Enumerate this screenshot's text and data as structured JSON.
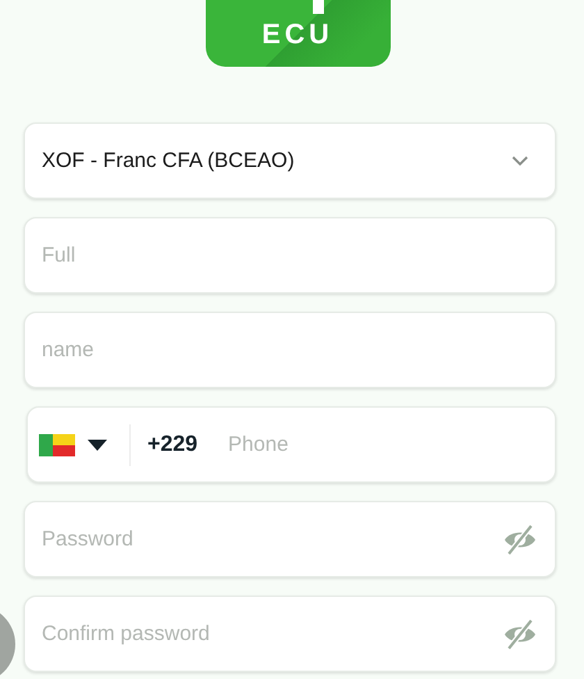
{
  "logo": {
    "text": "ECU"
  },
  "currency_select": {
    "value": "XOF - Franc CFA (BCEAO)"
  },
  "fields": [
    {
      "kind": "text",
      "placeholder": "Full"
    },
    {
      "kind": "text",
      "placeholder": "name"
    },
    {
      "kind": "phone",
      "dial_code": "+229",
      "placeholder": "Phone"
    },
    {
      "kind": "password",
      "placeholder": "Password"
    },
    {
      "kind": "password",
      "placeholder": "Confirm password"
    }
  ]
}
